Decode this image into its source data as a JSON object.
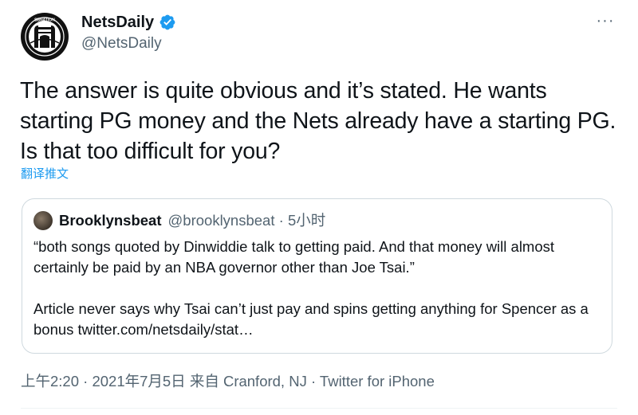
{
  "author": {
    "display_name": "NetsDaily",
    "handle": "@NetsDaily",
    "avatar_text": "SBNATION",
    "verified_color": "#1d9bf0"
  },
  "more_label": "···",
  "tweet_text": "The answer is quite obvious and it’s stated. He wants starting PG money and the Nets already have a starting PG. Is that too difficult for you?",
  "translate_label": "翻译推文",
  "quote": {
    "name": "Brooklynsbeat",
    "handle": "@brooklynsbeat",
    "separator": " · ",
    "time": "5小时",
    "paragraph1": "“both songs quoted by Dinwiddie talk to getting paid. And that money will almost certainly be paid by an NBA governor other than Joe Tsai.”",
    "paragraph2": "Article never says why Tsai can’t just pay and spins getting anything for Spencer as a bonus twitter.com/netsdaily/stat…"
  },
  "meta_line": "上午2:20 · 2021年7月5日 来自 Cranford, NJ · Twitter for iPhone",
  "colors": {
    "text": "#0f1419",
    "secondary": "#536471",
    "link": "#1d9bf0",
    "border": "#cfd9de"
  }
}
